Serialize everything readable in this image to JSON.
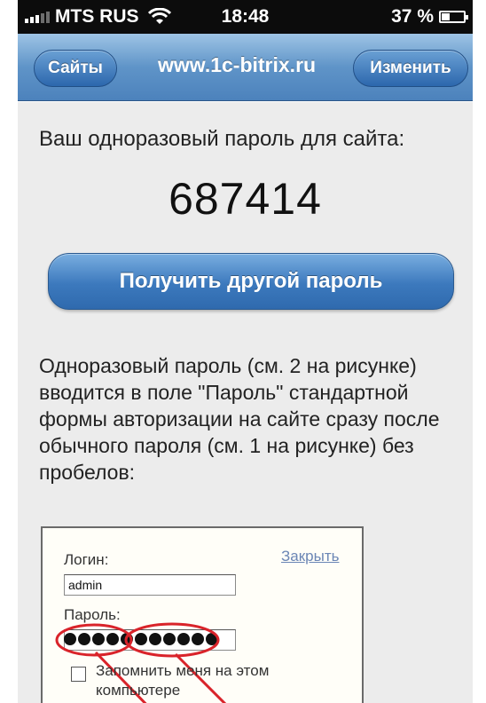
{
  "status_bar": {
    "carrier": "MTS RUS",
    "time": "18:48",
    "battery": "37 %",
    "battery_level": 0.37
  },
  "nav_bar": {
    "back_label": "Сайты",
    "title": "www.1c-bitrix.ru",
    "edit_label": "Изменить"
  },
  "main": {
    "lead_text": "Ваш одноразовый пароль для сайта:",
    "otp_code": "687414",
    "new_password_button": "Получить другой пароль",
    "description": "Одноразовый пароль (см. 2 на рисунке) вводится в поле \"Пароль\" стандартной формы авторизации на сайте сразу после обычного пароля (см. 1 на рисунке) без пробелов:"
  },
  "figure": {
    "login_label": "Логин:",
    "close_link": "Закрыть",
    "login_value": "admin",
    "password_label": "Пароль:",
    "password_mask_count": 11,
    "remember_text": "Запомнить меня на этом компьютере"
  },
  "colors": {
    "nav_bar": "#5f94c8",
    "button": "#3c79bd",
    "annotation": "#d9232a",
    "link": "#6b86b5"
  }
}
